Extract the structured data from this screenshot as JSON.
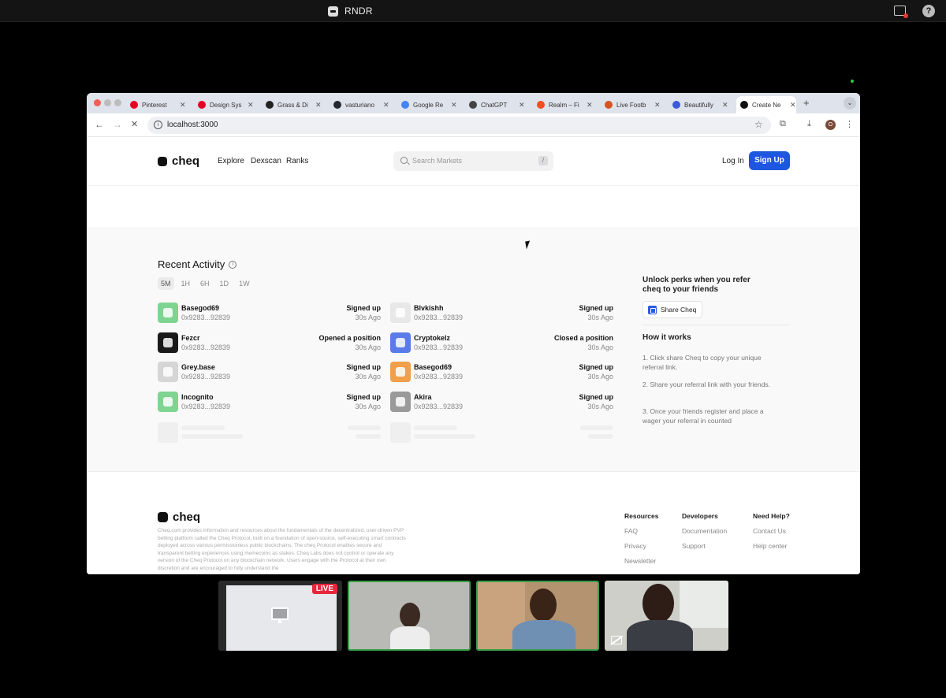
{
  "app": {
    "title": "RNDR"
  },
  "browser": {
    "tabs": [
      {
        "label": "Pinterest",
        "color": "#e60023"
      },
      {
        "label": "Design Sys",
        "color": "#e60023"
      },
      {
        "label": "Grass & Di",
        "color": "#222222"
      },
      {
        "label": "vasturiano",
        "color": "#24292f"
      },
      {
        "label": "Google Re",
        "color": "#4285f4"
      },
      {
        "label": "ChatGPT",
        "color": "#444444"
      },
      {
        "label": "Realm – Fi",
        "color": "#f24e1e"
      },
      {
        "label": "Live Footb",
        "color": "#d9531e"
      },
      {
        "label": "Beautifully",
        "color": "#3b5bdb"
      },
      {
        "label": "Create Ne",
        "color": "#111111",
        "active": true
      }
    ],
    "url": "localhost:3000",
    "profile_initial": "O"
  },
  "site": {
    "brand": "cheq",
    "nav": [
      "Explore",
      "Dexscan",
      "Ranks"
    ],
    "search_placeholder": "Search Markets",
    "search_shortcut": "/",
    "login": "Log In",
    "signup": "Sign Up"
  },
  "activity": {
    "title": "Recent Activity",
    "timeframes": [
      "5M",
      "1H",
      "6H",
      "1D",
      "1W"
    ],
    "active_timeframe": "5M",
    "left": [
      {
        "name": "Basegod69",
        "address": "0x9283...92839",
        "action": "Signed up",
        "time": "30s Ago",
        "color": "#7ed491"
      },
      {
        "name": "Fezcr",
        "address": "0x9283...92839",
        "action": "Opened a position",
        "time": "30s Ago",
        "color": "#1a1a1a"
      },
      {
        "name": "Grey.base",
        "address": "0x9283...92839",
        "action": "Signed up",
        "time": "30s Ago",
        "color": "#d6d6d6"
      },
      {
        "name": "Incognito",
        "address": "0x9283...92839",
        "action": "Signed up",
        "time": "30s Ago",
        "color": "#7ed491"
      }
    ],
    "right": [
      {
        "name": "Blvkishh",
        "address": "0x9283...92839",
        "action": "Signed up",
        "time": "30s Ago",
        "color": "#e8e8e8"
      },
      {
        "name": "Cryptokelz",
        "address": "0x9283...92839",
        "action": "Closed a position",
        "time": "30s Ago",
        "color": "#5b7be8"
      },
      {
        "name": "Basegod69",
        "address": "0x9283...92839",
        "action": "Signed up",
        "time": "30s Ago",
        "color": "#f0a04b"
      },
      {
        "name": "Akira",
        "address": "0x9283...92839",
        "action": "Signed up",
        "time": "30s Ago",
        "color": "#9a9a9a"
      }
    ]
  },
  "referral": {
    "title": "Unlock perks when you refer cheq to your friends",
    "share_button": "Share Cheq",
    "how_title": "How it works",
    "steps": [
      "1. Click share Cheq to copy your unique referral link.",
      "2. Share your referral link with your friends.",
      "3. Once your friends register and place a wager your referral in counted"
    ]
  },
  "footer": {
    "brand": "cheq",
    "disclaimer": "Cheq.com provides information and resources about the fundamentals of the decentralized, user-driven PVP betting platform called the Cheq Protocol, built on a foundation of open-source, self-executing smart contracts deployed across various permissionless public blockchains. The cheq Protocol enables secure and transparent betting experiences using memecoins as stakes. Cheq Labs does not control or operate any version of the Cheq Protocol on any blockchain network. Users engage with the Protocol at their own discretion and are encouraged to fully understand the",
    "columns": [
      {
        "title": "Resources",
        "links": [
          "FAQ",
          "Privacy",
          "Newsletter"
        ]
      },
      {
        "title": "Developers",
        "links": [
          "Documentation",
          "Support"
        ]
      },
      {
        "title": "Need Help?",
        "links": [
          "Contact Us",
          "Help center"
        ]
      }
    ]
  },
  "call": {
    "live_badge": "LIVE"
  }
}
